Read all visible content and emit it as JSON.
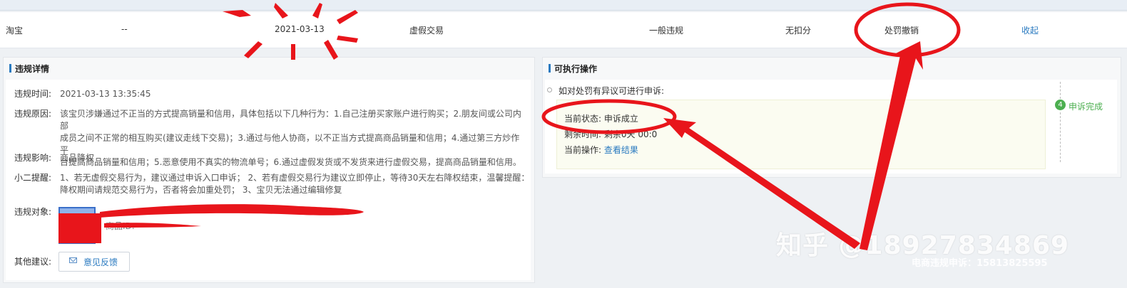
{
  "violation_summary": {
    "platform": "淘宝",
    "dash": "--",
    "date": "2021-03-13",
    "type": "虚假交易",
    "level": "一般违规",
    "deduction": "无扣分",
    "status": "处罚撤销",
    "collapse": "收起"
  },
  "details": {
    "title": "违规详情",
    "time_label": "违规时间:",
    "time_value": "2021-03-13 13:35:45",
    "reason_label": "违规原因:",
    "reason_lines": [
      "该宝贝涉嫌通过不正当的方式提高销量和信用，具体包括以下几种行为：1.自己注册买家账户进行购买；2.朋友间或公司内部",
      "成员之间不正常的相互购买(建议走线下交易)；3.通过与他人协商，以不正当方式提高商品销量和信用；4.通过第三方炒作平",
      "台提高商品销量和信用；5.恶意使用不真实的物流单号；6.通过虚假发货或不发货来进行虚假交易，提高商品销量和信用。"
    ],
    "impact_label": "违规影响:",
    "impact_value": "商品降权",
    "tip_label": "小二提醒:",
    "tip_lines": [
      "1、若无虚假交易行为，建议通过申诉入口申诉；  2、若有虚假交易行为建议立即停止，等待30天左右降权结束，温馨提醒：",
      "降权期间请规范交易行为，否者将会加重处罚；  3、宝贝无法通过编辑修复"
    ],
    "target_label": "违规对象:",
    "target_item_id_prefix": "商品ID:",
    "suggest_label": "其他建议:",
    "feedback_button": "意见反馈"
  },
  "actions": {
    "title": "可执行操作",
    "prompt": "如对处罚有异议可进行申诉:",
    "current_status_label": "当前状态:",
    "current_status_value": "申诉成立",
    "remaining_label": "剩余时间:",
    "remaining_value": "剩余0天 00:0",
    "current_op_label": "当前操作:",
    "current_op_link": "查看结果",
    "step_number": "4",
    "step_label": "申诉完成"
  },
  "watermark": {
    "main": "知乎 @18927834869",
    "sub": "电商违规申诉：15813825595"
  },
  "colors": {
    "link": "#2a7ac0",
    "step_green": "#4caf50",
    "annotation_red": "#e8151b"
  }
}
